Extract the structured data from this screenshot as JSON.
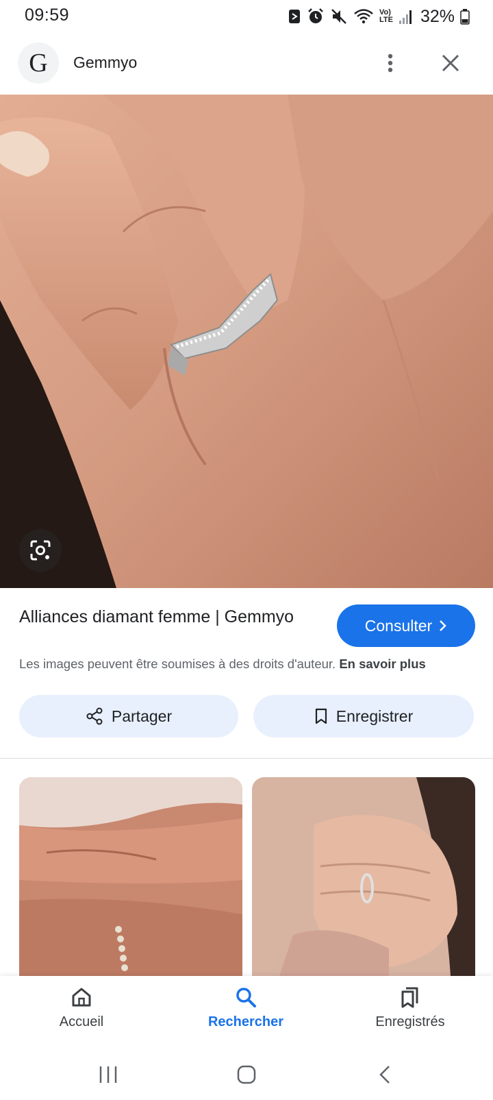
{
  "status_bar": {
    "time": "09:59",
    "battery": "32%",
    "network_label_top": "Vo)",
    "network_label_bottom": "LTE",
    "icons": [
      "nfc-icon",
      "alarm-icon",
      "mute-icon",
      "wifi-icon",
      "signal-icon",
      "battery-icon"
    ]
  },
  "header": {
    "logo_letter": "G",
    "site_name": "Gemmyo"
  },
  "result": {
    "title": "Alliances diamant femme | Gemmyo",
    "consult_label": "Consulter",
    "copyright_text": "Les images peuvent être soumises à des droits d'auteur.",
    "learn_more": "En savoir plus"
  },
  "actions": {
    "share_label": "Partager",
    "save_label": "Enregistrer"
  },
  "bottom_nav": {
    "items": [
      {
        "label": "Accueil",
        "icon": "home-icon"
      },
      {
        "label": "Rechercher",
        "icon": "search-icon"
      },
      {
        "label": "Enregistrés",
        "icon": "bookmarks-icon"
      }
    ]
  },
  "colors": {
    "accent": "#1a73e8",
    "pill_bg": "#e8f0fe"
  }
}
